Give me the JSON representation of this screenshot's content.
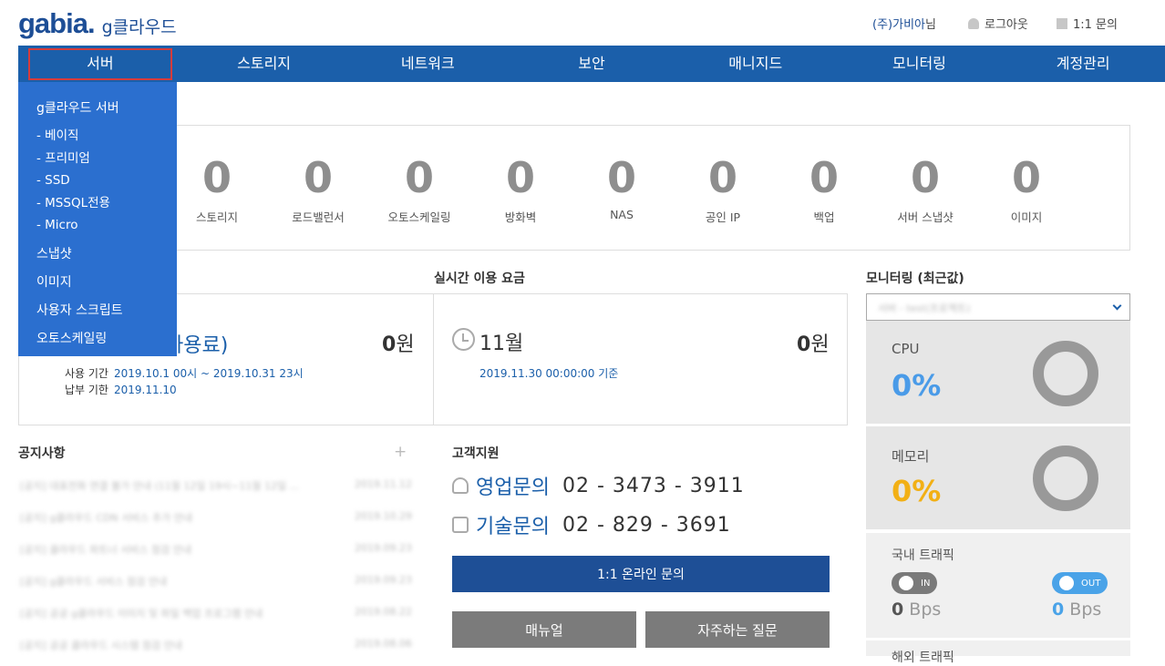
{
  "header": {
    "brand": "gabia.",
    "product": "g클라우드",
    "company": "(주)가비아",
    "honorific": "님",
    "logout": "로그아웃",
    "inquiry": "1:1 문의"
  },
  "nav": {
    "items": [
      "서버",
      "스토리지",
      "네트워크",
      "보안",
      "매니지드",
      "모니터링",
      "계정관리"
    ],
    "active": "서버"
  },
  "dropdown": {
    "heading": "g클라우드 서버",
    "subs": [
      "- 베이직",
      "- 프리미엄",
      "- SSD",
      "- MSSQL전용",
      "- Micro"
    ],
    "items": [
      "스냅샷",
      "이미지",
      "사용자 스크립트",
      "오토스케일링"
    ]
  },
  "summary": {
    "stats": [
      {
        "label": "스토리지",
        "value": "0"
      },
      {
        "label": "로드밸런서",
        "value": "0"
      },
      {
        "label": "오토스케일링",
        "value": "0"
      },
      {
        "label": "방화벽",
        "value": "0"
      },
      {
        "label": "NAS",
        "value": "0"
      },
      {
        "label": "공인 IP",
        "value": "0"
      },
      {
        "label": "백업",
        "value": "0"
      },
      {
        "label": "서버 스냅샷",
        "value": "0"
      },
      {
        "label": "이미지",
        "value": "0"
      }
    ]
  },
  "billing": {
    "title": "실시간 이용 요금",
    "left_title_partial": "사용료)",
    "left_amount_num": "0",
    "currency": "원",
    "period_label": "사용 기간",
    "period_value": "2019.10.1 00시 ~ 2019.10.31 23시",
    "due_label": "납부 기한",
    "due_value": "2019.11.10",
    "right_month": "11월",
    "right_amount_num": "0",
    "basis": "2019.11.30 00:00:00 기준"
  },
  "monitoring": {
    "title": "모니터링 (최근값)",
    "select_value": "서버 - test(프로젝트)",
    "cpu_label": "CPU",
    "cpu_value": "0%",
    "cpu_percent": 0,
    "mem_label": "메모리",
    "mem_value": "0%",
    "mem_percent": 0,
    "traffic_label": "국내 트래픽",
    "in_label": "IN",
    "out_label": "OUT",
    "in_num": "0",
    "out_num": "0",
    "unit": "Bps",
    "next_label": "해외 트래픽",
    "colors": {
      "cpu": "#4a9be8",
      "mem": "#f2b015",
      "in_pill": "#7a7a7a",
      "out_pill": "#4aa3e8"
    }
  },
  "notice": {
    "title": "공지사항",
    "plus": "+",
    "rows": [
      {
        "title": "[공지] 대표전화 연결 불가 안내 (11월 12일 19시~11월 12일 ...",
        "date": "2019.11.12"
      },
      {
        "title": "[공지] g클라우드 CDN 서비스 추가 안내",
        "date": "2019.10.29"
      },
      {
        "title": "[공지] 클라우드 파트너 서비스 점검 안내",
        "date": "2019.09.23"
      },
      {
        "title": "[공지] g클라우드 서비스 점검 안내",
        "date": "2019.09.23"
      },
      {
        "title": "[공지] 공공 g클라우드 이미지 및 파일 백업 프로그램 안내",
        "date": "2019.08.22"
      },
      {
        "title": "[공지] 공공 클라우드 시스템 점검 안내",
        "date": "2019.08.06"
      }
    ]
  },
  "support": {
    "title": "고객지원",
    "sales_label": "영업문의",
    "sales_phone": "02 - 3473 - 3911",
    "tech_label": "기술문의",
    "tech_phone": "02 - 829 - 3691",
    "online_btn": "1:1 온라인 문의",
    "manual_btn": "매뉴얼",
    "faq_btn": "자주하는 질문"
  }
}
